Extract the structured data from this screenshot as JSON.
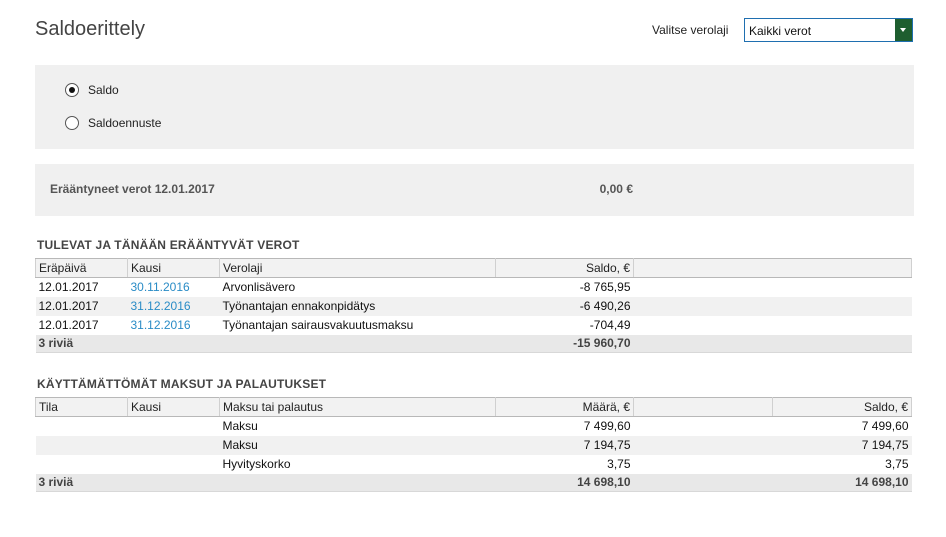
{
  "page": {
    "title": "Saldoerittely"
  },
  "tax_select": {
    "label": "Valitse verolaji",
    "value": "Kaikki verot"
  },
  "mode": {
    "options": [
      {
        "label": "Saldo",
        "checked": true
      },
      {
        "label": "Saldoennuste",
        "checked": false
      }
    ]
  },
  "overdue": {
    "label": "Erääntyneet verot 12.01.2017",
    "amount": "0,00 €"
  },
  "upcoming": {
    "title": "TULEVAT JA TÄNÄÄN ERÄÄNTYVÄT VEROT",
    "headers": [
      "Eräpäivä",
      "Kausi",
      "Verolaji",
      "Saldo, €",
      ""
    ],
    "rows": [
      {
        "due_date": "12.01.2017",
        "period": "30.11.2016",
        "tax_type": "Arvonlisävero",
        "balance": "-8 765,95"
      },
      {
        "due_date": "12.01.2017",
        "period": "31.12.2016",
        "tax_type": "Työnantajan ennakonpidätys",
        "balance": "-6 490,26"
      },
      {
        "due_date": "12.01.2017",
        "period": "31.12.2016",
        "tax_type": "Työnantajan sairausvakuutusmaksu",
        "balance": "-704,49"
      }
    ],
    "total": {
      "label": "3 riviä",
      "balance": "-15 960,70"
    }
  },
  "unused": {
    "title": "KÄYTTÄMÄTTÖMÄT MAKSUT JA PALAUTUKSET",
    "headers": [
      "Tila",
      "Kausi",
      "Maksu tai palautus",
      "Määrä, €",
      "",
      "Saldo, €"
    ],
    "rows": [
      {
        "status": "",
        "period": "",
        "item": "Maksu",
        "amount": "7 499,60",
        "balance": "7 499,60"
      },
      {
        "status": "",
        "period": "",
        "item": "Maksu",
        "amount": "7 194,75",
        "balance": "7 194,75"
      },
      {
        "status": "",
        "period": "",
        "item": "Hyvityskorko",
        "amount": "3,75",
        "balance": "3,75"
      }
    ],
    "total": {
      "label": "3 riviä",
      "amount": "14 698,10",
      "balance": "14 698,10"
    }
  },
  "colors": {
    "link": "#2a8cc6",
    "select_arrow": "#1e5e2f",
    "panel": "#f0f0f0"
  },
  "icons": {
    "select_arrow": "chevron-down-icon"
  }
}
